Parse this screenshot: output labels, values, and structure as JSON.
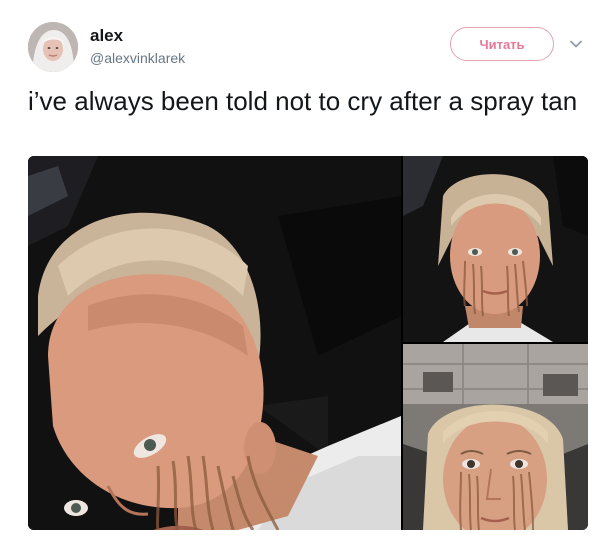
{
  "user": {
    "name": "alex",
    "handle": "@alexvinklarek"
  },
  "follow_label": "Читать",
  "tweet_text": "i’ve always been told not to cry after a spray tan",
  "colors": {
    "follow_accent": "#e57a98",
    "text": "#14171a",
    "secondary_text": "#657786"
  }
}
